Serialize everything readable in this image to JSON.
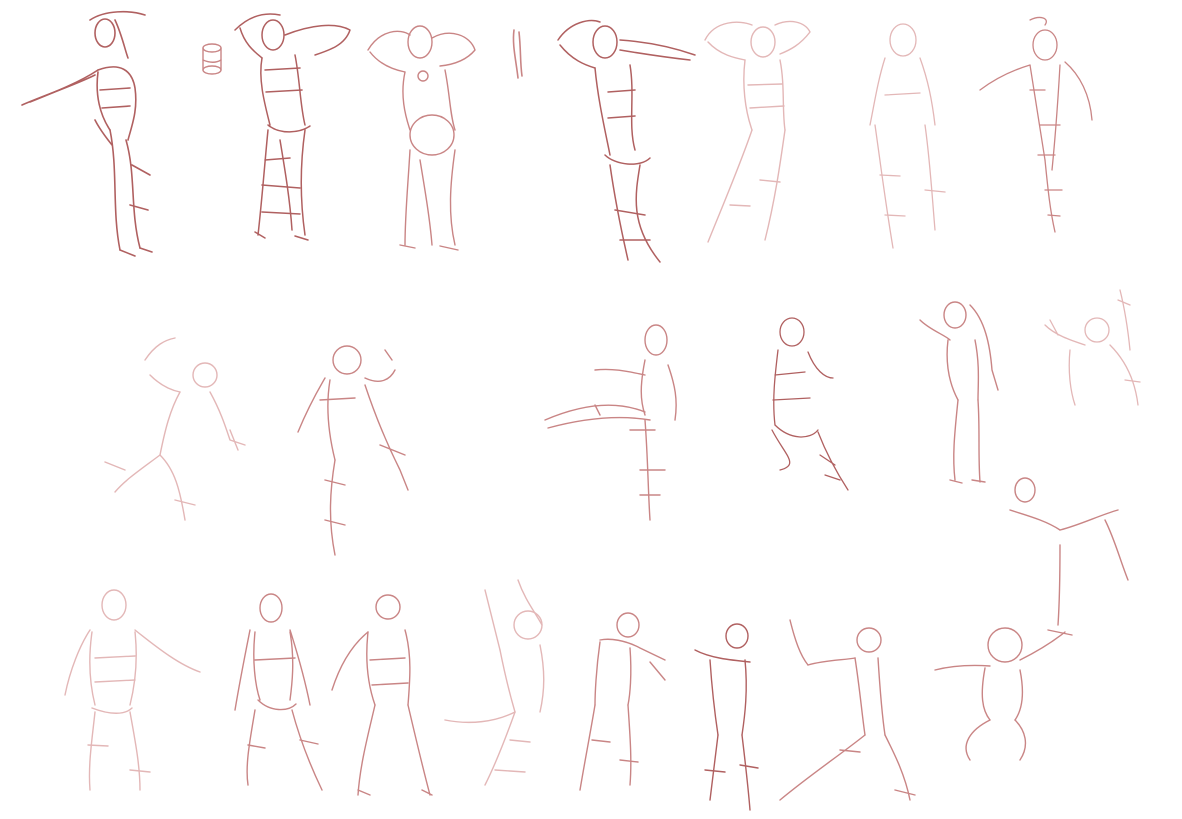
{
  "canvas": {
    "background": "#ffffff",
    "stroke_colors": {
      "dark": "#b06060",
      "mid": "#c98585",
      "light": "#e3b7b7"
    }
  },
  "figures": {
    "rows": [
      {
        "row": 1,
        "count": 9
      },
      {
        "row": 2,
        "count": 7
      },
      {
        "row": 3,
        "count": 9
      }
    ]
  }
}
